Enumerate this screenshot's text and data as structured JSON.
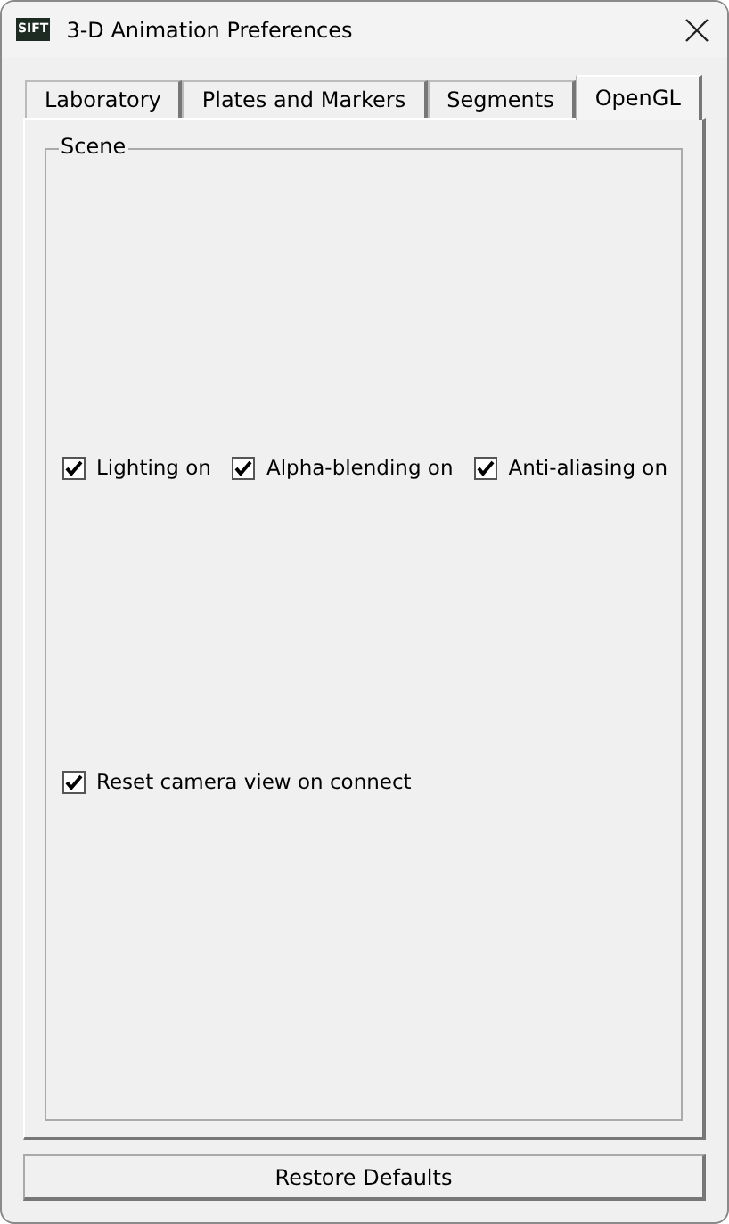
{
  "window": {
    "title": "3-D Animation Preferences",
    "app_icon": "SIFT"
  },
  "tabs": [
    {
      "label": "Laboratory",
      "selected": false
    },
    {
      "label": "Plates and Markers",
      "selected": false
    },
    {
      "label": "Segments",
      "selected": false
    },
    {
      "label": "OpenGL",
      "selected": true
    }
  ],
  "group": {
    "title": "Scene"
  },
  "options_row": [
    {
      "label": "Lighting on",
      "checked": true
    },
    {
      "label": "Alpha-blending on",
      "checked": true
    },
    {
      "label": "Anti-aliasing on",
      "checked": true
    }
  ],
  "options_bottom": [
    {
      "label": "Reset camera view on connect",
      "checked": true
    }
  ],
  "buttons": [
    "Restore Defaults"
  ]
}
